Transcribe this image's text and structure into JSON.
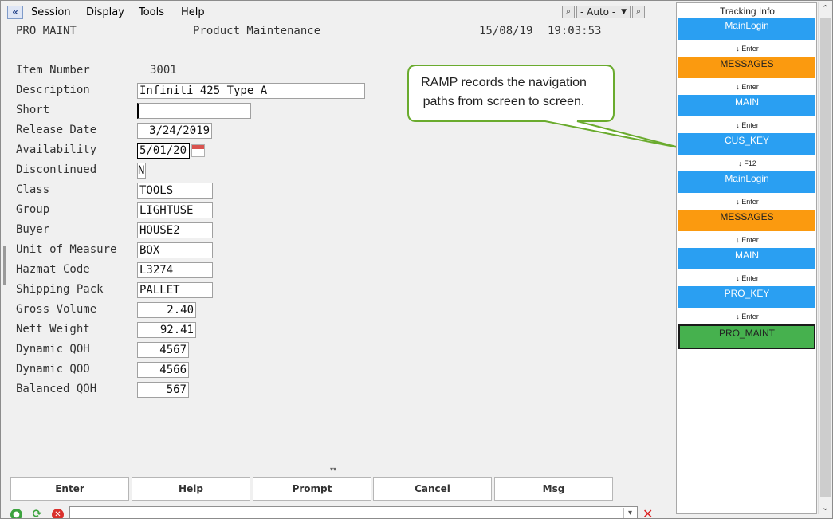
{
  "menu": {
    "back_glyph": "«",
    "items": [
      "Session",
      "Display",
      "Tools",
      "Help"
    ],
    "mode_select": "- Auto -"
  },
  "header": {
    "screen_id": "PRO_MAINT",
    "screen_title": "Product Maintenance",
    "date": "15/08/19",
    "time": "19:03:53"
  },
  "form": {
    "item_number_label": "Item Number",
    "item_number_value": "3001",
    "description_label": "Description",
    "description_value": "Infiniti 425 Type A",
    "short_label": "Short",
    "short_value": "",
    "release_date_label": "Release Date",
    "release_date_value": "3/24/2019",
    "availability_label": "Availability",
    "availability_value": "5/01/20",
    "discontinued_label": "Discontinued",
    "discontinued_value": "N",
    "class_label": "Class",
    "class_value": "TOOLS",
    "group_label": "Group",
    "group_value": "LIGHTUSE",
    "buyer_label": "Buyer",
    "buyer_value": "HOUSE2",
    "uom_label": "Unit of Measure",
    "uom_value": "BOX",
    "hazmat_label": "Hazmat Code",
    "hazmat_value": "L3274",
    "shipping_label": "Shipping Pack",
    "shipping_value": "PALLET",
    "gross_volume_label": "Gross Volume",
    "gross_volume_value": "2.40",
    "nett_weight_label": "Nett Weight",
    "nett_weight_value": "92.41",
    "dyn_qoh_label": "Dynamic QOH",
    "dyn_qoh_value": "4567",
    "dyn_qoo_label": "Dynamic QOO",
    "dyn_qoo_value": "4566",
    "bal_qoh_label": "Balanced QOH",
    "bal_qoh_value": "567"
  },
  "function_keys": [
    "Enter",
    "Help",
    "Prompt",
    "Cancel",
    "Msg"
  ],
  "callout": {
    "line1": "RAMP records the navigation",
    "line2": "paths from screen to screen."
  },
  "tracking": {
    "title": "Tracking Info",
    "steps": [
      {
        "screen": "MainLogin",
        "color": "blue",
        "key": "↓ Enter"
      },
      {
        "screen": "MESSAGES",
        "color": "orange",
        "key": "↓ Enter"
      },
      {
        "screen": "MAIN",
        "color": "blue",
        "key": "↓ Enter"
      },
      {
        "screen": "CUS_KEY",
        "color": "blue",
        "key": "↓ F12"
      },
      {
        "screen": "MainLogin",
        "color": "blue",
        "key": "↓ Enter"
      },
      {
        "screen": "MESSAGES",
        "color": "orange",
        "key": "↓ Enter"
      },
      {
        "screen": "MAIN",
        "color": "blue",
        "key": "↓ Enter"
      },
      {
        "screen": "PRO_KEY",
        "color": "blue",
        "key": "↓ Enter"
      },
      {
        "screen": "PRO_MAINT",
        "color": "green",
        "key": ""
      }
    ]
  },
  "colors": {
    "blue": "#2a9ff2",
    "orange": "#fb9a0f",
    "green": "#46b14e",
    "callout_border": "#6aab2e"
  }
}
